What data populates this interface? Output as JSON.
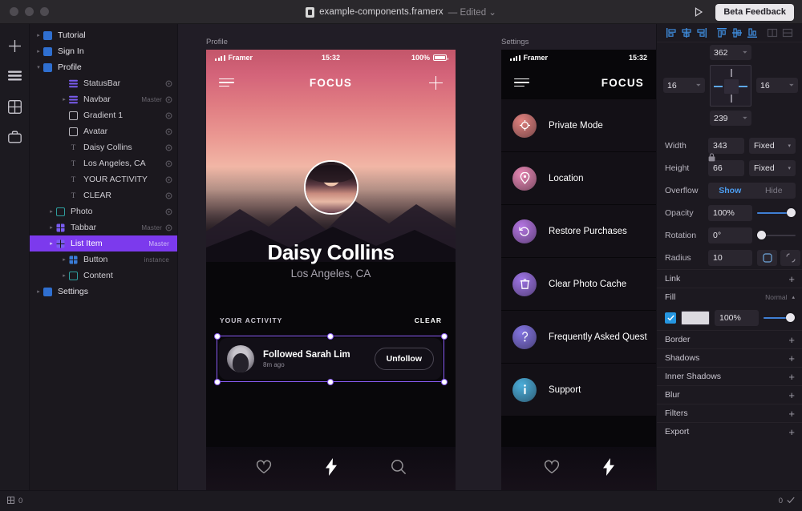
{
  "titlebar": {
    "file_name": "example-components.framerx",
    "edited_label": "— Edited ⌄",
    "play_icon": "play-icon",
    "beta_label": "Beta Feedback"
  },
  "rail": {
    "items": [
      {
        "icon": "plus-icon",
        "name": "insert-tool"
      },
      {
        "icon": "layers-icon",
        "name": "layers-tool"
      },
      {
        "icon": "components-grid-icon",
        "name": "components-tool"
      },
      {
        "icon": "assets-bag-icon",
        "name": "assets-tool"
      }
    ]
  },
  "layers": [
    {
      "label": "Tutorial",
      "depth": 0,
      "twisty": "▸",
      "icon": "frame-blue",
      "badge": "",
      "vis": false,
      "selected": false,
      "top": true
    },
    {
      "label": "Sign In",
      "depth": 0,
      "twisty": "▸",
      "icon": "frame-blue",
      "badge": "",
      "vis": false,
      "selected": false,
      "top": true
    },
    {
      "label": "Profile",
      "depth": 0,
      "twisty": "▾",
      "icon": "frame-blue",
      "badge": "",
      "vis": false,
      "selected": false,
      "top": true
    },
    {
      "label": "StatusBar",
      "depth": 2,
      "twisty": "",
      "icon": "stack-purple",
      "badge": "",
      "vis": true,
      "selected": false
    },
    {
      "label": "Navbar",
      "depth": 2,
      "twisty": "▸",
      "icon": "stack-purple",
      "badge": "Master",
      "vis": true,
      "selected": false
    },
    {
      "label": "Gradient 1",
      "depth": 2,
      "twisty": "",
      "icon": "frame-white",
      "badge": "",
      "vis": true,
      "selected": false
    },
    {
      "label": "Avatar",
      "depth": 2,
      "twisty": "",
      "icon": "frame-white",
      "badge": "",
      "vis": true,
      "selected": false
    },
    {
      "label": "Daisy Collins",
      "depth": 2,
      "twisty": "",
      "icon": "text",
      "badge": "",
      "vis": true,
      "selected": false
    },
    {
      "label": "Los Angeles, CA",
      "depth": 2,
      "twisty": "",
      "icon": "text",
      "badge": "",
      "vis": true,
      "selected": false
    },
    {
      "label": "YOUR ACTIVITY",
      "depth": 2,
      "twisty": "",
      "icon": "text",
      "badge": "",
      "vis": true,
      "selected": false
    },
    {
      "label": "CLEAR",
      "depth": 2,
      "twisty": "",
      "icon": "text",
      "badge": "",
      "vis": true,
      "selected": false
    },
    {
      "label": "Photo",
      "depth": 1,
      "twisty": "▸",
      "icon": "frame-teal",
      "badge": "",
      "vis": true,
      "selected": false
    },
    {
      "label": "Tabbar",
      "depth": 1,
      "twisty": "▸",
      "icon": "grid-purple",
      "badge": "Master",
      "vis": true,
      "selected": false
    },
    {
      "label": "List Item",
      "depth": 1,
      "twisty": "▸",
      "icon": "grid-purple",
      "badge": "Master",
      "vis": false,
      "selected": true
    },
    {
      "label": "Button",
      "depth": 2,
      "twisty": "▸",
      "icon": "grid-blue",
      "badge": "instance",
      "vis": false,
      "selected": false
    },
    {
      "label": "Content",
      "depth": 2,
      "twisty": "▸",
      "icon": "frame-teal",
      "badge": "",
      "vis": false,
      "selected": false
    },
    {
      "label": "Settings",
      "depth": 0,
      "twisty": "▸",
      "icon": "frame-blue",
      "badge": "",
      "vis": false,
      "selected": false,
      "top": true
    }
  ],
  "canvas": {
    "frame1_label": "Profile",
    "frame2_label": "Settings",
    "statusbar": {
      "carrier": "Framer",
      "time": "15:32",
      "battery_pct": "100%"
    },
    "navbar": {
      "title": "FOCUS",
      "menu_icon": "hamburger-icon",
      "add_icon": "plus-icon"
    },
    "profile": {
      "name": "Daisy Collins",
      "location": "Los Angeles, CA",
      "activity_label": "YOUR ACTIVITY",
      "clear_label": "CLEAR",
      "item": {
        "title": "Followed Sarah Lim",
        "time": "8m ago",
        "button_label": "Unfollow"
      }
    },
    "tabbar": [
      {
        "icon": "heart-icon",
        "active": false
      },
      {
        "icon": "bolt-icon",
        "active": true
      },
      {
        "icon": "search-icon",
        "active": false
      }
    ],
    "tabbar_small": [
      {
        "icon": "heart-icon",
        "active": false
      },
      {
        "icon": "bolt-icon",
        "active": true
      }
    ],
    "settings_rows": [
      {
        "label": "Private Mode",
        "icon": "private-mode-icon",
        "color": "#f08a86"
      },
      {
        "label": "Location",
        "icon": "location-pin-icon",
        "color": "#f58fbe"
      },
      {
        "label": "Restore Purchases",
        "icon": "restore-icon",
        "color": "#c07df2"
      },
      {
        "label": "Clear Photo Cache",
        "icon": "trash-icon",
        "color": "#a87cf5"
      },
      {
        "label": "Frequently Asked Quest",
        "icon": "question-icon",
        "color": "#8b7cf0"
      },
      {
        "label": "Support",
        "icon": "info-icon",
        "color": "#4fb9e8"
      }
    ]
  },
  "props": {
    "align_icons": [
      {
        "name": "align-left-icon",
        "on": true
      },
      {
        "name": "align-center-h-icon",
        "on": true
      },
      {
        "name": "align-right-icon",
        "on": true
      },
      {
        "name": "align-top-icon",
        "on": true
      },
      {
        "name": "align-center-v-icon",
        "on": true
      },
      {
        "name": "align-bottom-icon",
        "on": true
      },
      {
        "name": "distribute-h-icon",
        "on": false
      },
      {
        "name": "distribute-v-icon",
        "on": false
      }
    ],
    "constraints": {
      "top": "362",
      "top_unit": "⏷",
      "left": "16",
      "left_unit": "⏷",
      "right": "16",
      "right_unit": "⏷",
      "bottom": "239",
      "bottom_unit": "⏷"
    },
    "width": {
      "label": "Width",
      "value": "343",
      "mode": "Fixed"
    },
    "height": {
      "label": "Height",
      "value": "66",
      "mode": "Fixed"
    },
    "overflow": {
      "label": "Overflow",
      "show": "Show",
      "hide": "Hide",
      "selected": "Show"
    },
    "opacity": {
      "label": "Opacity",
      "value": "100%",
      "pct": 100
    },
    "rotation": {
      "label": "Rotation",
      "value": "0°",
      "pct": 0
    },
    "radius": {
      "label": "Radius",
      "value": "10"
    },
    "sections": [
      {
        "label": "Link",
        "type": "plus"
      },
      {
        "label": "Fill",
        "type": "mode",
        "mode": "Normal"
      },
      {
        "label": "Border",
        "type": "plus"
      },
      {
        "label": "Shadows",
        "type": "plus"
      },
      {
        "label": "Inner Shadows",
        "type": "plus"
      },
      {
        "label": "Blur",
        "type": "plus"
      },
      {
        "label": "Filters",
        "type": "plus"
      },
      {
        "label": "Export",
        "type": "plus"
      }
    ],
    "fill": {
      "opacity": "100%",
      "pct": 100,
      "enabled": true,
      "swatch": "#dcdae0"
    }
  },
  "footer": {
    "left_count": "0",
    "right_count": "0"
  },
  "colors": {
    "accent_purple": "#7c3aed",
    "accent_blue": "#4c9df0",
    "panel_bg": "#1c1920",
    "canvas_bg": "#211d26"
  }
}
